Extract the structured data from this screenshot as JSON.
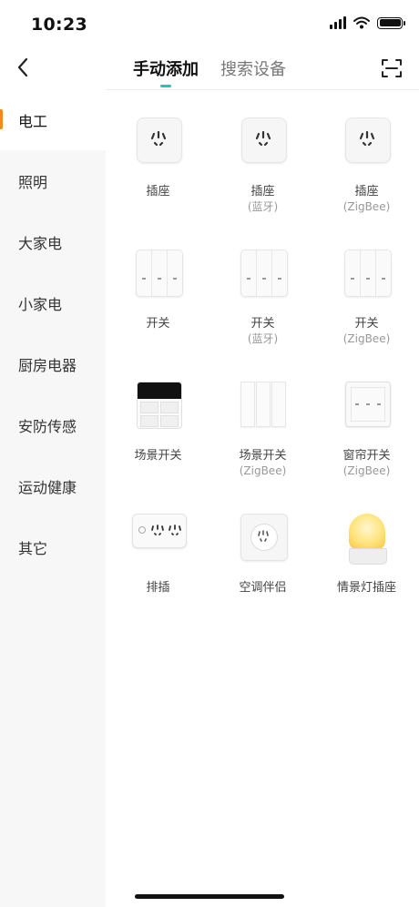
{
  "status": {
    "time": "10:23"
  },
  "nav": {
    "tabs": [
      {
        "label": "手动添加",
        "active": true
      },
      {
        "label": "搜索设备",
        "active": false
      }
    ]
  },
  "sidebar": {
    "items": [
      {
        "label": "电工",
        "active": true
      },
      {
        "label": "照明"
      },
      {
        "label": "大家电"
      },
      {
        "label": "小家电"
      },
      {
        "label": "厨房电器"
      },
      {
        "label": "安防传感"
      },
      {
        "label": "运动健康"
      },
      {
        "label": "其它"
      }
    ]
  },
  "devices": [
    {
      "name": "插座",
      "sub": "",
      "icon": "socket-icon"
    },
    {
      "name": "插座",
      "sub": "(蓝牙)",
      "icon": "socket-icon"
    },
    {
      "name": "插座",
      "sub": "(ZigBee)",
      "icon": "socket-icon"
    },
    {
      "name": "开关",
      "sub": "",
      "icon": "switch-icon"
    },
    {
      "name": "开关",
      "sub": "(蓝牙)",
      "icon": "switch-icon"
    },
    {
      "name": "开关",
      "sub": "(ZigBee)",
      "icon": "switch-icon"
    },
    {
      "name": "场景开关",
      "sub": "",
      "icon": "scene-switch-icon"
    },
    {
      "name": "场景开关",
      "sub": "(ZigBee)",
      "icon": "scene-switch-icon"
    },
    {
      "name": "窗帘开关",
      "sub": "(ZigBee)",
      "icon": "curtain-switch-icon"
    },
    {
      "name": "排插",
      "sub": "",
      "icon": "power-strip-icon"
    },
    {
      "name": "空调伴侣",
      "sub": "",
      "icon": "ac-companion-icon"
    },
    {
      "name": "情景灯插座",
      "sub": "",
      "icon": "night-light-icon"
    }
  ],
  "colors": {
    "accent": "#2fbfb7",
    "sidebar_active": "#f08a1c"
  }
}
